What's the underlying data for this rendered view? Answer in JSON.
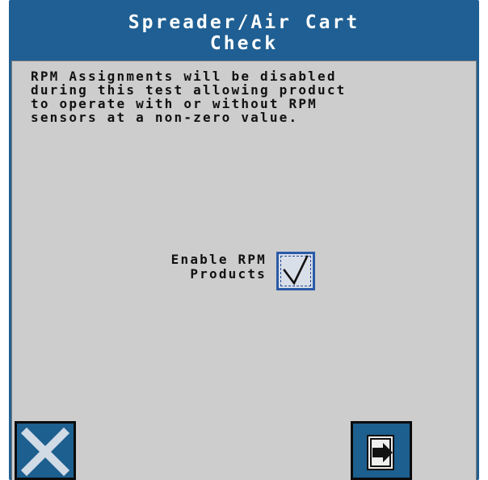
{
  "screen": {
    "title": "Spreader/Air Cart\nCheck",
    "message": "RPM Assignments will be disabled\nduring this test allowing product\nto operate with or without RPM\nsensors at a non-zero value.",
    "enable_rpm": {
      "label": "Enable RPM\nProducts",
      "checked": true
    }
  },
  "softkeys": {
    "cancel": {
      "icon": "close-icon"
    },
    "next": {
      "icon": "arrow-next-icon"
    }
  },
  "colors": {
    "header_blue": "#1f5f93",
    "panel_gray": "#cdcdcd",
    "checkbox_blue": "#2a5aa8"
  }
}
